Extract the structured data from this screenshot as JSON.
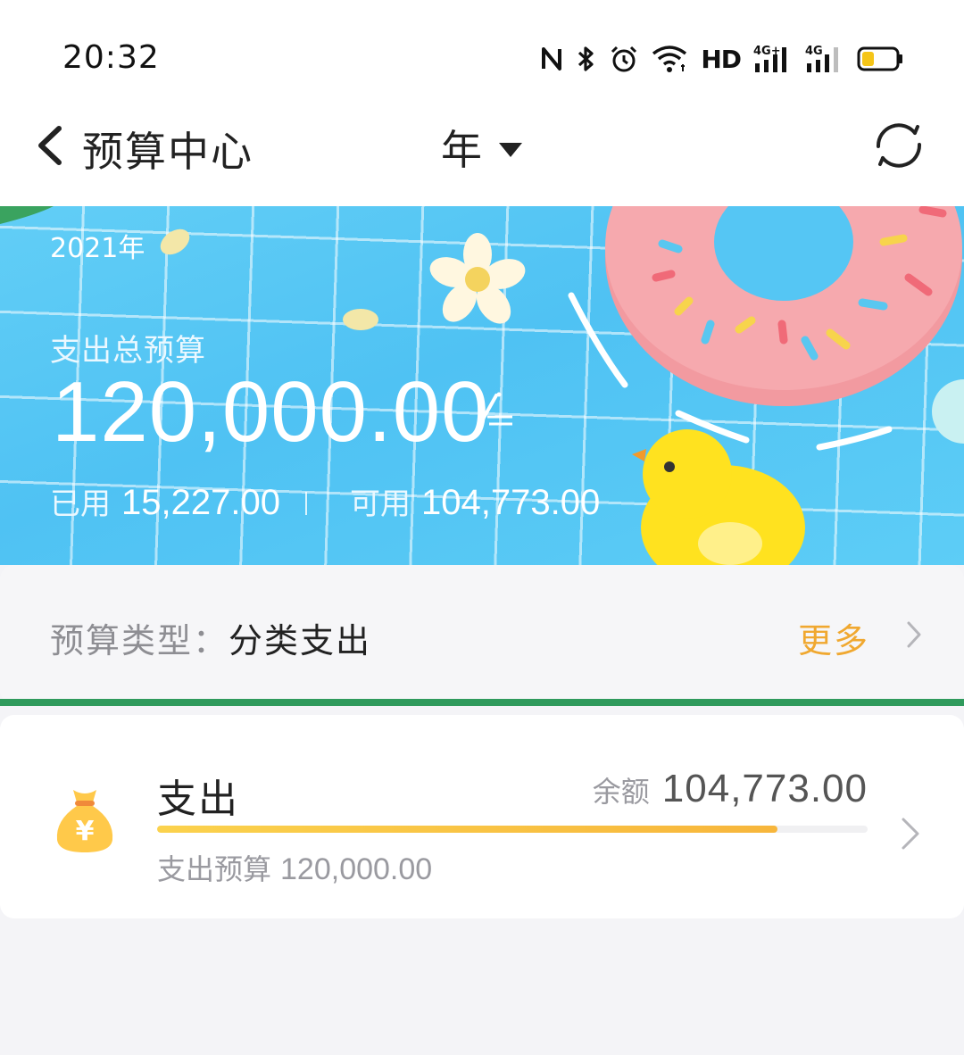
{
  "status_bar": {
    "time": "20:32",
    "hd_label": "HD",
    "icons": [
      "nfc-icon",
      "bluetooth-icon",
      "alarm-icon",
      "wifi-icon",
      "hd-icon",
      "signal-4g-plus-icon",
      "signal-4g-icon",
      "battery-icon"
    ],
    "battery_level": 0.35
  },
  "header": {
    "back_icon": "chevron-left-icon",
    "title": "预算中心",
    "period": "年",
    "period_icon": "caret-down-icon",
    "refresh_icon": "refresh-icon"
  },
  "banner": {
    "year": "2021年",
    "total_label": "支出总预算",
    "total_amount": "120,000.00",
    "edit_icon": "edit-icon",
    "used_label": "已用",
    "used_amount": "15,227.00",
    "available_label": "可用",
    "available_amount": "104,773.00"
  },
  "budget_type": {
    "label": "预算类型：",
    "value": "分类支出",
    "more_label": "更多",
    "chevron_icon": "chevron-right-icon"
  },
  "expense": {
    "icon": "money-bag-icon",
    "title": "支出",
    "balance_label": "余额",
    "balance_amount": "104,773.00",
    "progress_remaining_fraction": 0.873,
    "budget_label": "支出预算",
    "budget_amount": "120,000.00",
    "chevron_icon": "chevron-right-icon"
  },
  "colors": {
    "accent": "#f0a830",
    "progress_start": "#fbd24d",
    "progress_end": "#f7b63c",
    "banner_water": "#55c6f4"
  }
}
